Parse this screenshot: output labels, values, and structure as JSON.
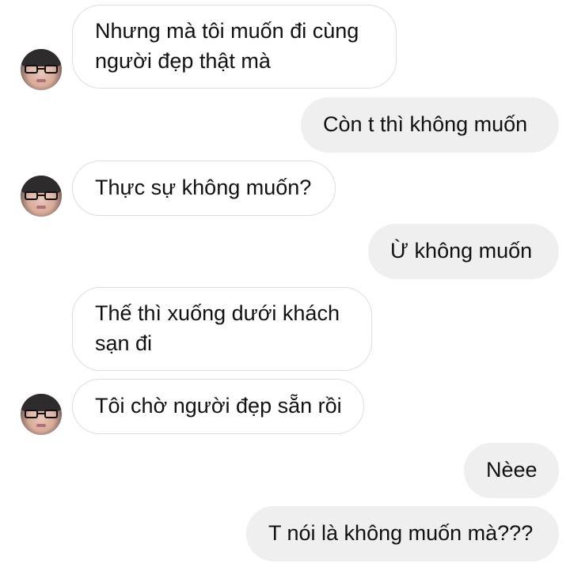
{
  "messages": [
    {
      "sender": "other",
      "lines": [
        "Nhưng mà tôi muốn đi cùng",
        "người đẹp thật mà"
      ]
    },
    {
      "sender": "me",
      "lines": [
        "Còn t thì không muốn"
      ]
    },
    {
      "sender": "other",
      "lines": [
        "Thực sự không muốn?"
      ]
    },
    {
      "sender": "me",
      "lines": [
        "Ừ không muốn"
      ]
    },
    {
      "sender": "other",
      "lines": [
        "Thế thì xuống dưới khách",
        "sạn đi"
      ]
    },
    {
      "sender": "other",
      "lines": [
        "Tôi chờ người đẹp sẵn rồi"
      ]
    },
    {
      "sender": "me",
      "lines": [
        "Nèee"
      ]
    },
    {
      "sender": "me",
      "lines": [
        "T nói là không muốn mà???"
      ]
    }
  ],
  "colors": {
    "incoming_border": "#dedede",
    "outgoing_background": "#efefef",
    "text": "#111111"
  },
  "icons": {
    "avatar": "user-avatar-with-glasses"
  }
}
